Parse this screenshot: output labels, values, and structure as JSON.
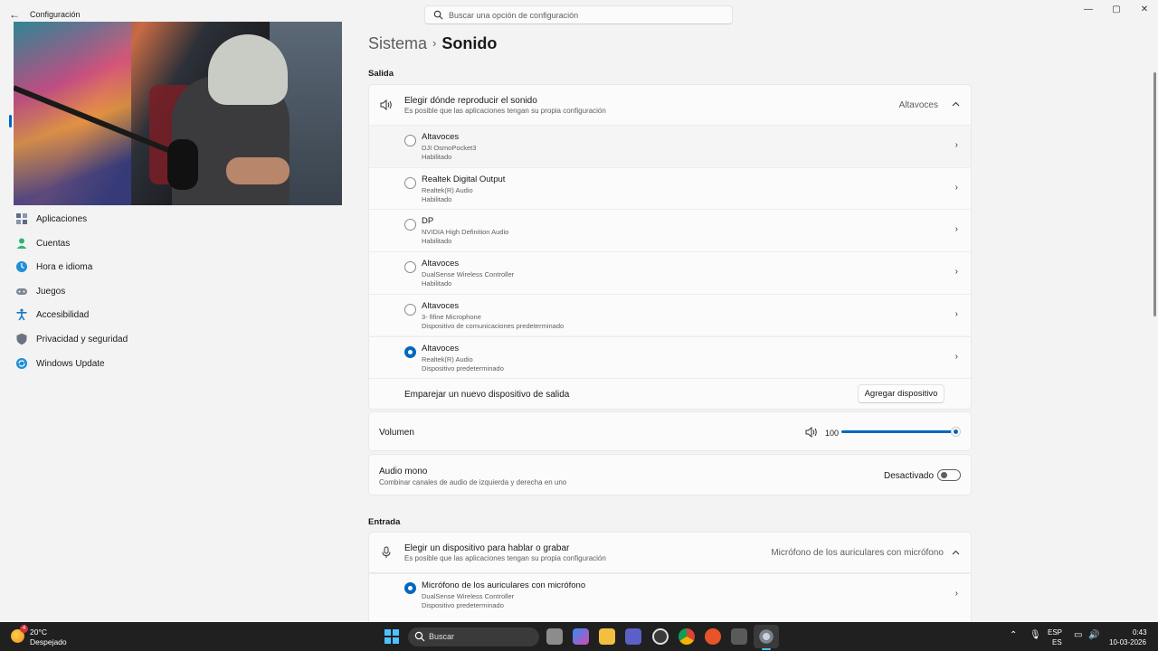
{
  "window": {
    "title": "Configuración",
    "search_placeholder": "Buscar una opción de configuración",
    "controls": {
      "minimize": "—",
      "maximize": "▢",
      "close": "✕"
    }
  },
  "sidebar": {
    "items": [
      {
        "label": "Aplicaciones",
        "icon": "apps-icon",
        "color": "#5b6c86"
      },
      {
        "label": "Cuentas",
        "icon": "accounts-icon",
        "color": "#2bb673"
      },
      {
        "label": "Hora e idioma",
        "icon": "globe-clock-icon",
        "color": "#1f8fd6"
      },
      {
        "label": "Juegos",
        "icon": "gamepad-icon",
        "color": "#7c8794"
      },
      {
        "label": "Accesibilidad",
        "icon": "accessibility-icon",
        "color": "#1a78c2"
      },
      {
        "label": "Privacidad y seguridad",
        "icon": "shield-icon",
        "color": "#6c7380"
      },
      {
        "label": "Windows Update",
        "icon": "windows-update-icon",
        "color": "#1f8fd6"
      }
    ]
  },
  "breadcrumb": {
    "parent": "Sistema",
    "separator": "›",
    "current": "Sonido"
  },
  "output": {
    "section_title": "Salida",
    "chooser": {
      "title": "Elegir dónde reproducir el sonido",
      "subtitle": "Es posible que las aplicaciones tengan su propia configuración",
      "value": "Altavoces"
    },
    "devices": [
      {
        "name": "Altavoces",
        "sub": "DJI OsmoPocket3",
        "status": "Habilitado",
        "selected": false
      },
      {
        "name": "Realtek Digital Output",
        "sub": "Realtek(R) Audio",
        "status": "Habilitado",
        "selected": false
      },
      {
        "name": "DP",
        "sub": "NVIDIA High Definition Audio",
        "status": "Habilitado",
        "selected": false
      },
      {
        "name": "Altavoces",
        "sub": "DualSense Wireless Controller",
        "status": "Habilitado",
        "selected": false
      },
      {
        "name": "Altavoces",
        "sub": "3- fifine Microphone",
        "status": "Dispositivo de comunicaciones predeterminado",
        "selected": false
      },
      {
        "name": "Altavoces",
        "sub": "Realtek(R) Audio",
        "status": "Dispositivo predeterminado",
        "selected": true
      }
    ],
    "pair": {
      "label": "Emparejar un nuevo dispositivo de salida",
      "button": "Agregar dispositivo"
    },
    "volume": {
      "label": "Volumen",
      "value": "100",
      "level": 1.0
    },
    "mono": {
      "title": "Audio mono",
      "subtitle": "Combinar canales de audio de izquierda y derecha en uno",
      "state": "Desactivado"
    }
  },
  "input": {
    "section_title": "Entrada",
    "chooser": {
      "title": "Elegir un dispositivo para hablar o grabar",
      "subtitle": "Es posible que las aplicaciones tengan su propia configuración",
      "value": "Micrófono de los auriculares con micrófono"
    },
    "devices": [
      {
        "name": "Micrófono de los auriculares con micrófono",
        "sub": "DualSense Wireless Controller",
        "status": "Dispositivo predeterminado",
        "selected": true
      }
    ]
  },
  "taskbar": {
    "weather": {
      "temp": "20°C",
      "desc": "Despejado",
      "badge": "4"
    },
    "search": "Buscar",
    "lang": "ESP",
    "layout": "ES",
    "time": "0:43",
    "date": "10-03-2026"
  },
  "colors": {
    "accent": "#0067c0",
    "taskbar": "#202020"
  }
}
